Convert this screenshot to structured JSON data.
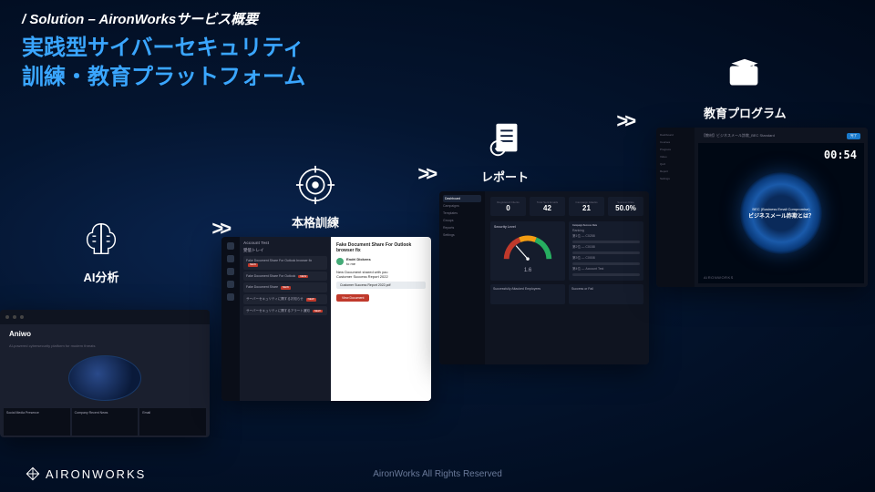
{
  "header": {
    "kicker": "/ Solution  – AironWorksサービス概要",
    "headline_l1": "実践型サイバーセキュリティ",
    "headline_l2": "訓練・教育プラットフォーム"
  },
  "steps": [
    {
      "label": "AI分析"
    },
    {
      "label": "本格訓練"
    },
    {
      "label": "レポート"
    },
    {
      "label": "教育プログラム"
    }
  ],
  "arrow": ">>",
  "shot1": {
    "title": "Aniwo",
    "tagline": "AI-powered cybersecurity platform for modern threats",
    "panel1": "Social Media Presence",
    "panel2": "Company Recent News",
    "panel3": "Email"
  },
  "shot2": {
    "account": "Account Test",
    "listTitle": "受信トレイ",
    "items": [
      "Fake Document Share For Outlook browser fix",
      "Fake Document Share For Outlook",
      "Fake Document Share",
      "サーバーセキュリティに関するお知らせ",
      "サーバーセキュリティに関するアラート通知"
    ],
    "tag": "NEW",
    "mailTitle": "Fake Document Share For Outlook browser fix",
    "mailFrom": "Endri Dickens",
    "mailTo": "to me",
    "mailBody1": "New Document shared with you",
    "mailBody2": "Customer Success Report 2022",
    "mailAtt": "Customer Success Report 2022.pdf",
    "mailBtn": "View Document"
  },
  "shot3": {
    "side": [
      "Dashboard",
      "Campaigns",
      "Templates",
      "Groups",
      "Reports",
      "Settings"
    ],
    "sideActive": "Dashboard",
    "statsLabels": [
      "Registered Clients",
      "Total Sent Emails",
      "Campaign Attacks",
      "Success Rate"
    ],
    "statsValues": [
      "0",
      "42",
      "21",
      "50.0%"
    ],
    "gaugeTitle": "Security Level",
    "gaugeValue": "1.6",
    "campaignTitle": "Campaign Success Rate",
    "campaignLines": [
      "Ranking",
      "第1位 — C0258",
      "第2位 — C0158",
      "第3位 — C0008",
      "第4位 — Account Test"
    ],
    "bot1": "Successfully Attacked Employees",
    "bot2": "Success or Fail"
  },
  "shot4": {
    "side": [
      "Dashboard",
      "Courses",
      "Progress",
      "Video",
      "Quiz",
      "Report",
      "Settings"
    ],
    "topTitle": "【教材】ビジネスメール詐欺_BEC Standard",
    "done": "完了",
    "portalT1": "BEC (Business Email Compromise)",
    "portalT2": "ビジネスメール詐欺とは？",
    "timer": "00:54",
    "brand": "AIRONWORKS"
  },
  "footer": {
    "logo": "AIRONWORKS",
    "copyright": "AironWorks  All  Rights   Reserved"
  }
}
